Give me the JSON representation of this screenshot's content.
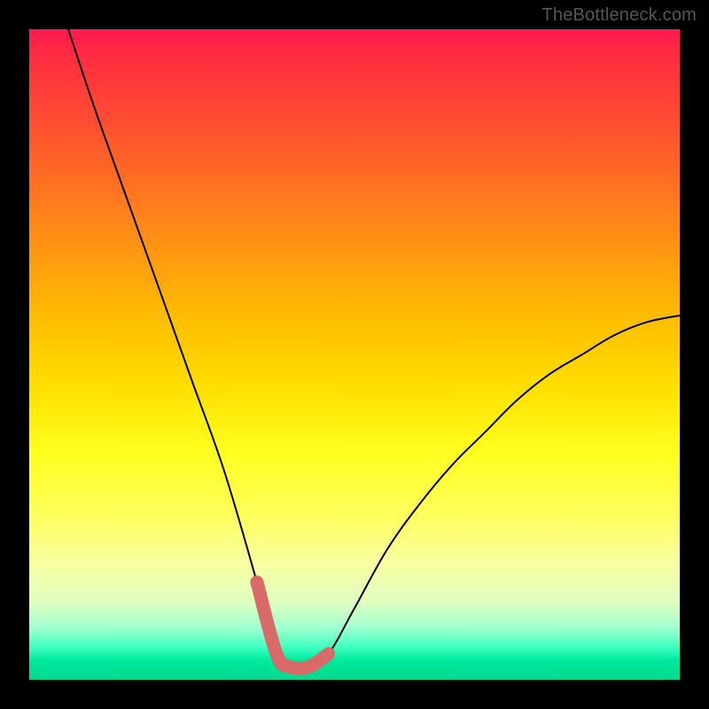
{
  "watermark": "TheBottleneck.com",
  "chart_data": {
    "type": "line",
    "title": "",
    "subtitle": "",
    "xlabel": "",
    "ylabel": "",
    "xlim": [
      0,
      100
    ],
    "ylim": [
      0,
      100
    ],
    "grid": false,
    "legend": false,
    "annotations": [],
    "series": [
      {
        "name": "bottleneck-curve",
        "description": "V-shaped bottleneck curve; minimum region sits near x≈38–46, y≈2. Left arm begins at top-left (x≈6, y≈100) and descends steeply. Right arm rises toward (x≈100, y≈56).",
        "x": [
          6,
          10,
          15,
          20,
          25,
          30,
          35,
          38,
          40,
          43,
          46,
          50,
          55,
          60,
          65,
          70,
          75,
          80,
          85,
          90,
          95,
          100
        ],
        "values": [
          100,
          88,
          74,
          60,
          46,
          32,
          15,
          4,
          2,
          2,
          4,
          11,
          20,
          27,
          33,
          38,
          43,
          47,
          50,
          53,
          55,
          56
        ]
      },
      {
        "name": "highlight-min-region",
        "description": "Thick highlight segment tracing the bottom of the V (the recommended balance zone).",
        "x": [
          35,
          38,
          40,
          43,
          46
        ],
        "values": [
          15,
          4,
          2,
          2,
          4
        ]
      }
    ]
  }
}
